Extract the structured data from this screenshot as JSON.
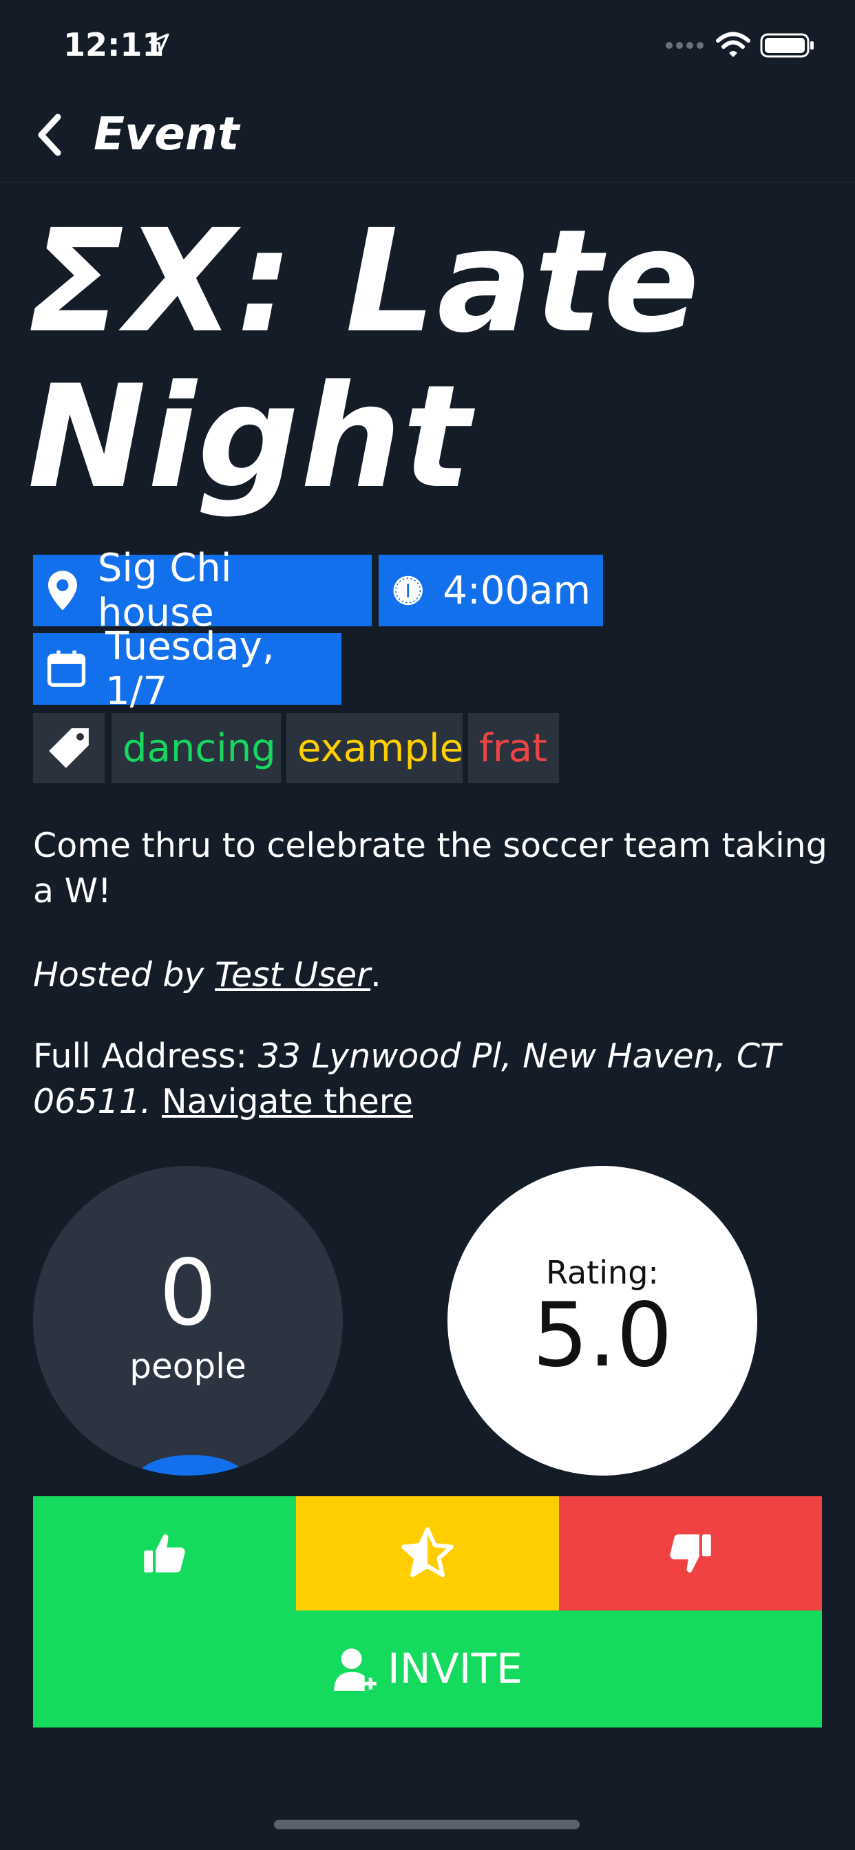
{
  "status_bar": {
    "time": "12:11"
  },
  "nav": {
    "title": "Event"
  },
  "event": {
    "title_line1": "ΣX: Late",
    "title_line2": "Night",
    "location": "Sig Chi house",
    "time": "4:00am",
    "date": "Tuesday, 1/7",
    "tags": [
      {
        "label": "dancing",
        "color": "#16d860"
      },
      {
        "label": "example",
        "color": "#ffd000"
      },
      {
        "label": "frat",
        "color": "#f04444"
      }
    ],
    "description": "Come thru to celebrate the soccer team taking a W!",
    "hosted_prefix": "Hosted by ",
    "host_name": "Test User",
    "hosted_suffix": ".",
    "address_label": "Full Address: ",
    "address": "33 Lynwood Pl, New Haven, CT 06511.",
    "navigate_link": "Navigate there"
  },
  "stats": {
    "people_count": "0",
    "people_label": "people",
    "rating_label": "Rating:",
    "rating_value": "5.0"
  },
  "actions": {
    "like_color": "#14db5e",
    "star_color": "#ffce00",
    "dislike_color": "#f04242",
    "invite_label": "INVITE"
  },
  "icons": [
    "location-pin-icon",
    "clock-icon",
    "calendar-icon",
    "tag-icon",
    "thumbs-up-icon",
    "star-icon",
    "thumbs-down-icon",
    "add-user-icon"
  ]
}
